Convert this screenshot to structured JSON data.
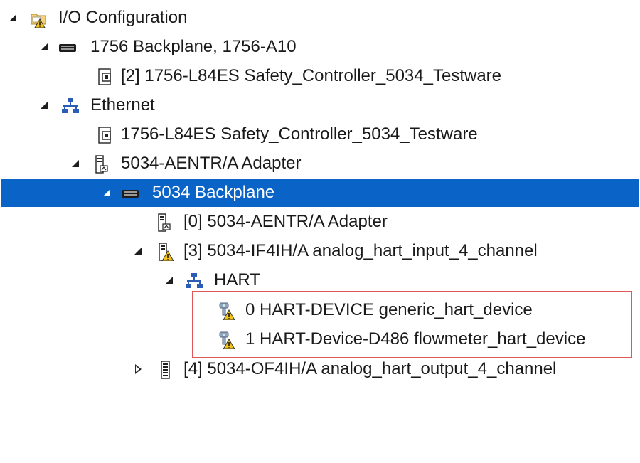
{
  "tree": {
    "root": {
      "label": "I/O Configuration",
      "icon": "folder-warning-icon"
    },
    "backplane_1756": {
      "label": "1756 Backplane, 1756-A10",
      "icon": "backplane-icon"
    },
    "controller_slot2": {
      "label": "[2] 1756-L84ES Safety_Controller_5034_Testware",
      "icon": "controller-icon"
    },
    "ethernet": {
      "label": "Ethernet",
      "icon": "network-icon"
    },
    "controller_eth": {
      "label": "1756-L84ES Safety_Controller_5034_Testware",
      "icon": "controller-icon"
    },
    "adapter": {
      "label": "5034-AENTR/A Adapter",
      "icon": "adapter-module-icon"
    },
    "backplane_5034": {
      "label": "5034 Backplane",
      "icon": "backplane-icon"
    },
    "adapter_slot0": {
      "label": "[0] 5034-AENTR/A Adapter",
      "icon": "adapter-module-icon"
    },
    "input_module": {
      "label": "[3] 5034-IF4IH/A analog_hart_input_4_channel",
      "icon": "module-warning-icon"
    },
    "hart": {
      "label": "HART",
      "icon": "network-icon"
    },
    "hart_device_0": {
      "label": "0 HART-DEVICE generic_hart_device",
      "icon": "hart-device-warning-icon"
    },
    "hart_device_1": {
      "label": "1 HART-Device-D486 flowmeter_hart_device",
      "icon": "hart-device-warning-icon"
    },
    "output_module": {
      "label": "[4] 5034-OF4IH/A analog_hart_output_4_channel",
      "icon": "module-icon"
    }
  },
  "colors": {
    "selection": "#0a64c8",
    "highlight_border": "#e0575a",
    "network_blue": "#2a5cb8",
    "warning_yellow": "#f2c21b"
  }
}
